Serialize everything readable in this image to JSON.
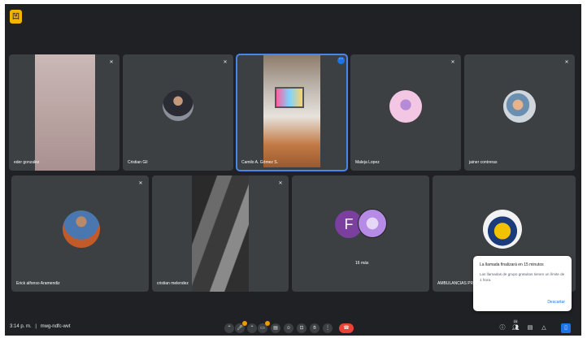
{
  "app": {
    "logo_glyph": "凹",
    "brand_color": "#f3b400"
  },
  "participants": [
    {
      "name": "eder gonzalez"
    },
    {
      "name": "Cristian Gil"
    },
    {
      "name": "Camilo A. Gómez S."
    },
    {
      "name": "Maleja Lopez"
    },
    {
      "name": "jainer contreras"
    },
    {
      "name": "Erick alfonso Aramendiz"
    },
    {
      "name": "cristian melendez"
    },
    {
      "name": "16 más"
    },
    {
      "name": "AMBULANCIAS PRO"
    }
  ],
  "group_tile": {
    "initial": "F"
  },
  "meeting": {
    "time": "3:14 p. m.",
    "separator": "|",
    "code": "mwg-ndfc-wvt"
  },
  "people_count": "24",
  "popup": {
    "title": "La llamada finalizará en 15 minutos",
    "body": "Las llamadas de grupo gratuitas tienen un límite de 1 hora.",
    "button": "Descartar"
  },
  "icons": {
    "mic": "mic-off-icon",
    "more": "more-vert-icon",
    "info": "info-icon",
    "people": "people-icon",
    "chat": "chat-icon",
    "activities": "activities-icon",
    "host": "host-controls-icon"
  },
  "colors": {
    "tile": "#3c4043",
    "background": "#202124",
    "accent": "#1a73e8",
    "end_call": "#ea4335"
  }
}
